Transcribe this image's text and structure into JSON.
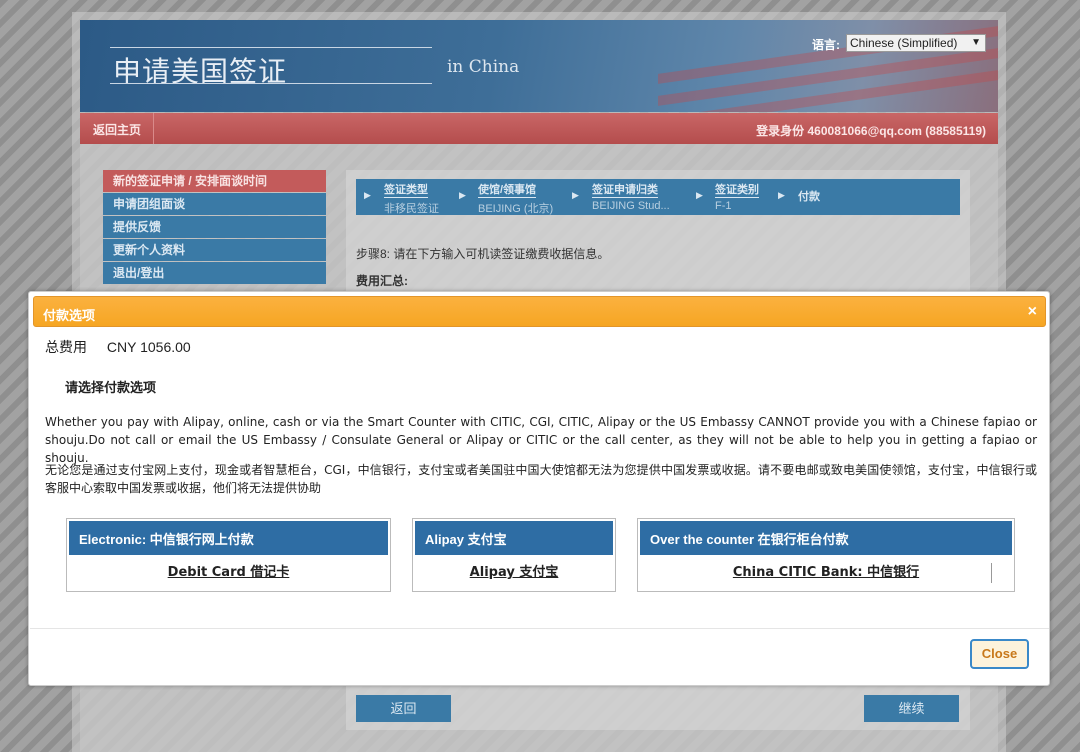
{
  "header": {
    "title": "申请美国签证",
    "subtitle": "in China",
    "language_label": "语言:",
    "language_value": "Chinese (Simplified)"
  },
  "topbar": {
    "home_link": "返回主页",
    "login_info": "登录身份 460081066@qq.com (88585119)"
  },
  "sidebar": {
    "items": [
      {
        "label": "新的签证申请 / 安排面谈时间"
      },
      {
        "label": "申请团组面谈"
      },
      {
        "label": "提供反馈"
      },
      {
        "label": "更新个人资料"
      },
      {
        "label": "退出/登出"
      }
    ]
  },
  "breadcrumb": [
    {
      "label": "签证类型",
      "value": "非移民签证"
    },
    {
      "label": "使馆/领事馆",
      "value": "BEIJING (北京)"
    },
    {
      "label": "签证申请归类",
      "value": "BEIJING Stud..."
    },
    {
      "label": "签证类别",
      "value": "F-1"
    },
    {
      "label": "付款",
      "value": ""
    }
  ],
  "content": {
    "step_text": "步骤8: 请在下方输入可机读签证缴费收据信息。",
    "fee_summary": "费用汇总:",
    "back_button": "返回",
    "continue_button": "继续"
  },
  "modal": {
    "title": "付款选项",
    "close_x": "×",
    "total_label": "总费用",
    "total_amount": "CNY 1056.00",
    "choose_label": "请选择付款选项",
    "notice_en": "Whether you pay with Alipay, online, cash or via the Smart Counter with CITIC, CGI, CITIC, Alipay or the US Embassy CANNOT provide you with a Chinese fapiao or shouju.Do not call or email the US Embassy / Consulate General or Alipay or CITIC or the call center, as they will not be able to help you in getting a fapiao or shouju.",
    "notice_zh": "无论您是通过支付宝网上支付，现金或者智慧柜台，CGI，中信银行，支付宝或者美国驻中国大使馆都无法为您提供中国发票或收据。请不要电邮或致电美国使领馆，支付宝，中信银行或客服中心索取中国发票或收据，他们将无法提供协助",
    "payment_options": [
      {
        "header": "Electronic: 中信银行网上付款",
        "link": "Debit Card 借记卡"
      },
      {
        "header": "Alipay 支付宝",
        "link": "Alipay 支付宝"
      },
      {
        "header": "Over the counter 在银行柜台付款",
        "link": "China CITIC Bank: 中信银行"
      }
    ],
    "close_button": "Close"
  }
}
